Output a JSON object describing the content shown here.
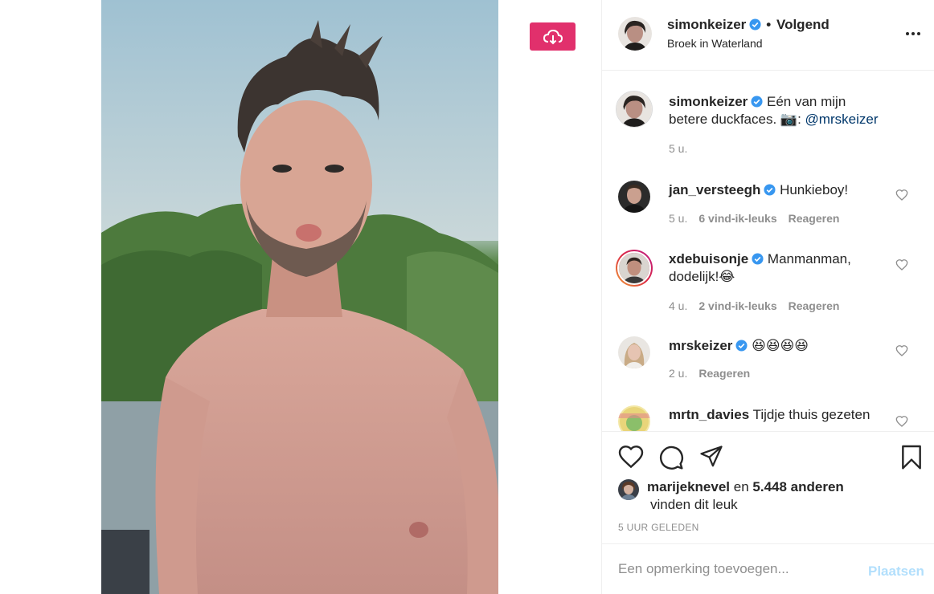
{
  "post": {
    "author": "simonkeizer",
    "follow_status": "Volgend",
    "location": "Broek in Waterland",
    "verified": true
  },
  "caption": {
    "username": "simonkeizer",
    "text": "Eén van mijn betere duckfaces. 📷:",
    "mention": "@mrskeizer",
    "time": "5 u."
  },
  "comments": [
    {
      "username": "jan_versteegh",
      "verified": true,
      "text": "Hunkieboy!",
      "time": "5 u.",
      "likes": "6 vind-ik-leuks",
      "reply": "Reageren"
    },
    {
      "username": "xdebuisonje",
      "verified": true,
      "text": "Manmanman, dodelijk!😂",
      "time": "4 u.",
      "likes": "2 vind-ik-leuks",
      "reply": "Reageren"
    },
    {
      "username": "mrskeizer",
      "verified": true,
      "text": "😆😆😆😆",
      "time": "2 u.",
      "reply": "Reageren"
    },
    {
      "username": "mrtn_davies",
      "verified": false,
      "text": "Tijdje thuis gezeten"
    }
  ],
  "likes": {
    "user": "marijeknevel",
    "connector": "en",
    "others": "5.448 anderen",
    "suffix": "vinden dit leuk"
  },
  "timestamp": "5 UUR GELEDEN",
  "add_comment": {
    "placeholder": "Een opmerking toevoegen...",
    "post_label": "Plaatsen"
  },
  "colors": {
    "accent": "#e1306c",
    "verified": "#3897f0",
    "post_button_disabled": "#b2dffc",
    "mention": "#00376b"
  },
  "icons": [
    "download-icon",
    "more-icon",
    "verified-icon",
    "heart-icon",
    "comment-icon",
    "share-icon",
    "bookmark-icon"
  ]
}
